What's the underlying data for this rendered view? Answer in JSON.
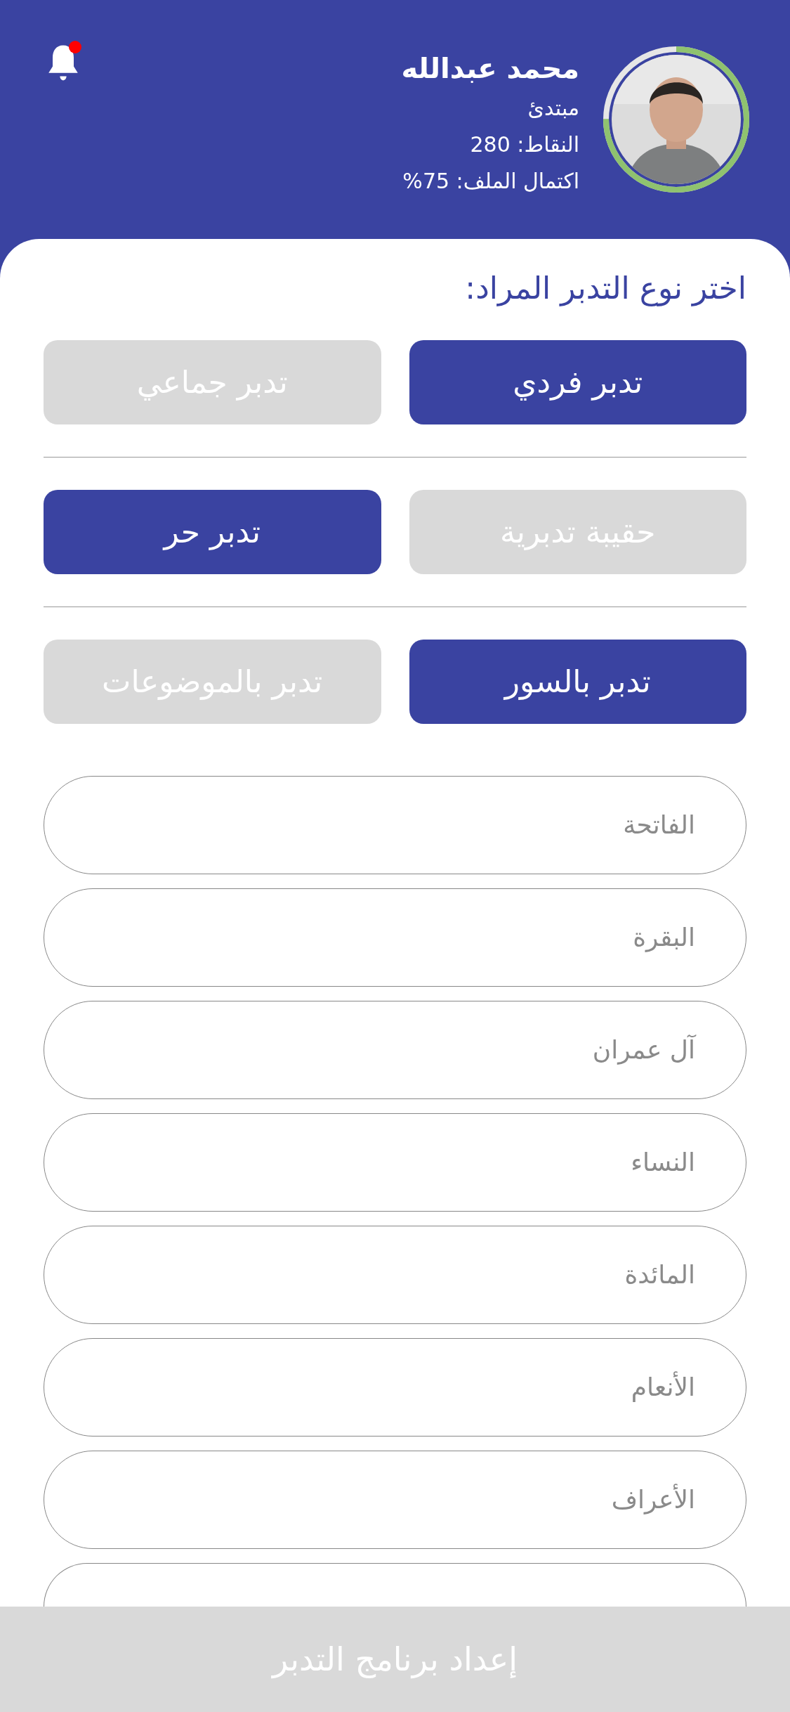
{
  "header": {
    "name": "محمد عبدالله",
    "rank": "مبتدئ",
    "points": "النقاط: 280",
    "completion": "اكتمال الملف: 75%",
    "notifications": {
      "unread": true
    }
  },
  "title": "اختر نوع التدبر المراد:",
  "option_groups": [
    [
      {
        "label": "تدبر فردي",
        "selected": true
      },
      {
        "label": "تدبر جماعي",
        "selected": false
      }
    ],
    [
      {
        "label": "حقيبة تدبرية",
        "selected": false
      },
      {
        "label": "تدبر حر",
        "selected": true
      }
    ],
    [
      {
        "label": "تدبر بالسور",
        "selected": true
      },
      {
        "label": "تدبر بالموضوعات",
        "selected": false
      }
    ]
  ],
  "surah_fields": [
    {
      "placeholder": "الفاتحة"
    },
    {
      "placeholder": "البقرة"
    },
    {
      "placeholder": "آل عمران"
    },
    {
      "placeholder": "النساء"
    },
    {
      "placeholder": "المائدة"
    },
    {
      "placeholder": "الأنعام"
    },
    {
      "placeholder": "الأعراف"
    }
  ],
  "submit_button": "إعداد برنامج التدبر"
}
